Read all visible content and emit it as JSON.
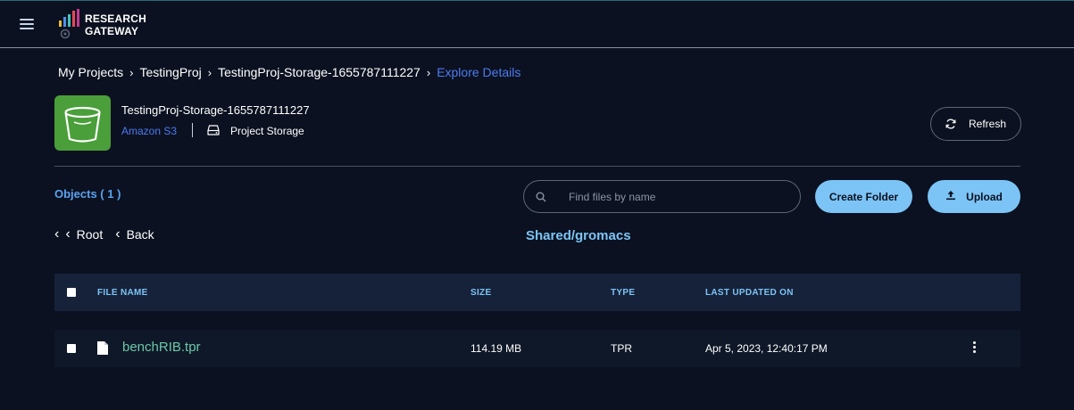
{
  "app": {
    "logo_line1": "RESEARCH",
    "logo_line2": "GATEWAY"
  },
  "breadcrumb": [
    {
      "label": "My Projects"
    },
    {
      "label": "TestingProj"
    },
    {
      "label": "TestingProj-Storage-1655787111227"
    },
    {
      "label": "Explore Details"
    }
  ],
  "store": {
    "name": "TestingProj-Storage-1655787111227",
    "type": "Amazon S3",
    "category": "Project Storage",
    "icon": "s3-bucket-icon"
  },
  "toolbar": {
    "refresh_label": "Refresh",
    "create_folder_label": "Create Folder",
    "upload_label": "Upload"
  },
  "objects_label": "Objects ( 1 )",
  "search": {
    "placeholder": "Find files by name",
    "value": ""
  },
  "nav": {
    "root_label": "Root",
    "back_label": "Back"
  },
  "current_path": "Shared/gromacs",
  "table": {
    "headers": {
      "file_name": "FILE NAME",
      "size": "SIZE",
      "type": "TYPE",
      "last_updated": "LAST UPDATED ON"
    },
    "rows": [
      {
        "file_name": "benchRIB.tpr",
        "size": "114.19 MB",
        "type": "TPR",
        "last_updated": "Apr 5, 2023, 12:40:17 PM"
      }
    ]
  },
  "colors": {
    "background": "#0b1120",
    "accent_blue": "#4e7bf0",
    "light_blue": "#7cc4f5",
    "file_link": "#6cc8a8",
    "bucket_green": "#4a9f3a"
  }
}
